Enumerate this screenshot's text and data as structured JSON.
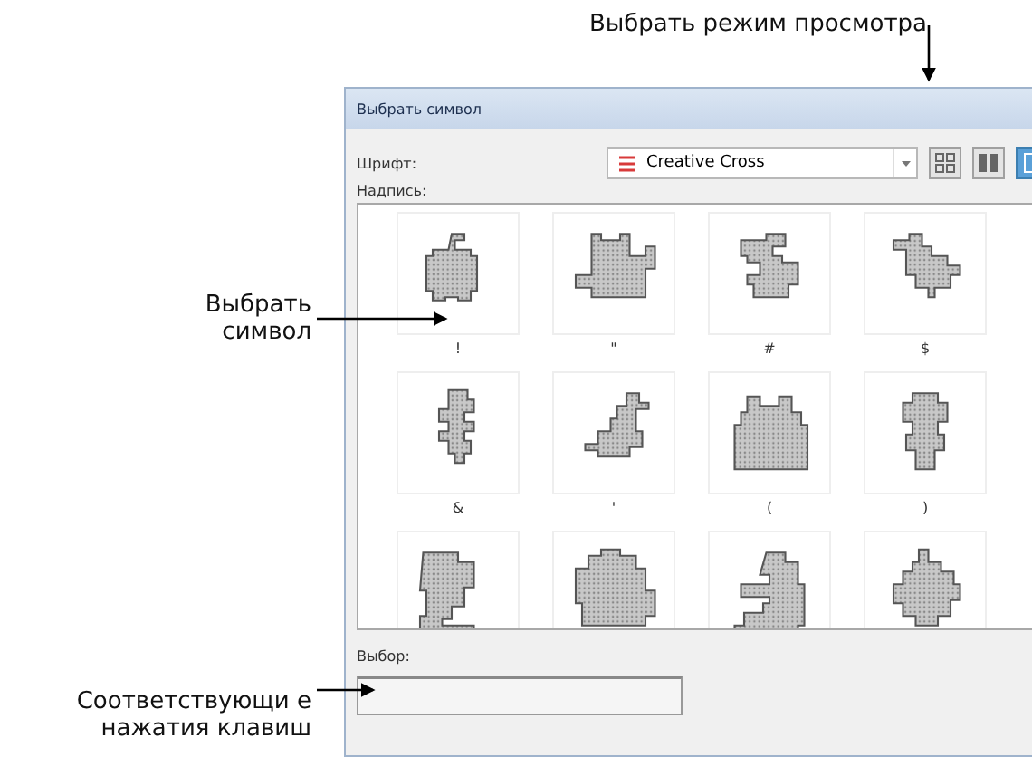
{
  "callouts": {
    "view_mode": "Выбрать режим просмотра",
    "select_symbol": "Выбрать символ",
    "keystrokes": "Соответствующи е нажатия клавиш"
  },
  "dialog": {
    "title": "Выбрать символ",
    "font_label": "Шрифт:",
    "font_value": "Creative Cross",
    "view_modes": [
      {
        "kind": "small",
        "selected": false
      },
      {
        "kind": "medium",
        "selected": false
      },
      {
        "kind": "large",
        "selected": true
      }
    ],
    "inscription_label": "Надпись:",
    "symbols": [
      {
        "kind": "apple",
        "caption": "!"
      },
      {
        "kind": "cat",
        "caption": "\""
      },
      {
        "kind": "cherries",
        "caption": "#"
      },
      {
        "kind": "bird",
        "caption": "$"
      },
      {
        "kind": "flower",
        "caption": "&"
      },
      {
        "kind": "goose",
        "caption": "'"
      },
      {
        "kind": "house",
        "caption": "("
      },
      {
        "kind": "tree",
        "caption": ")"
      },
      {
        "kind": "branch"
      },
      {
        "kind": "rock"
      },
      {
        "kind": "moon"
      },
      {
        "kind": "bush"
      }
    ],
    "selection_label": "Выбор:"
  }
}
